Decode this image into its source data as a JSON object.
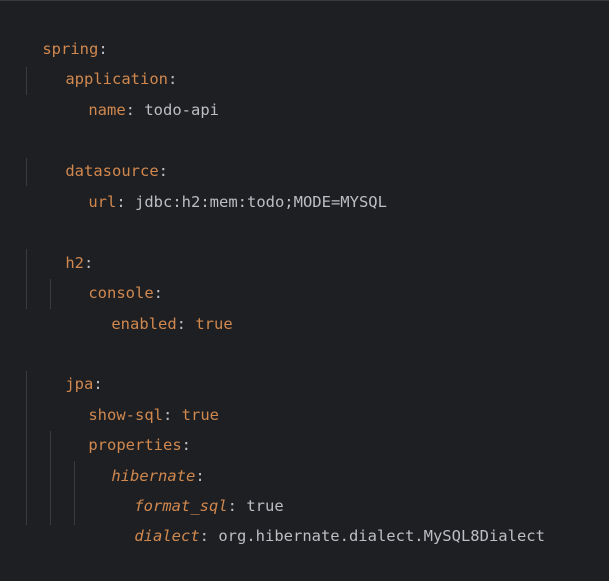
{
  "lines": [
    {
      "key": "spring",
      "value": ""
    },
    {
      "key": "application",
      "value": ""
    },
    {
      "key": "name",
      "value": "todo-api"
    },
    {
      "key": "datasource",
      "value": ""
    },
    {
      "key": "url",
      "value": "jdbc:h2:mem:todo;MODE=MYSQL"
    },
    {
      "key": "h2",
      "value": ""
    },
    {
      "key": "console",
      "value": ""
    },
    {
      "key": "enabled",
      "value": "true"
    },
    {
      "key": "jpa",
      "value": ""
    },
    {
      "key": "show-sql",
      "value": "true"
    },
    {
      "key": "properties",
      "value": ""
    },
    {
      "key": "hibernate",
      "value": ""
    },
    {
      "key": "format_sql",
      "value": "true"
    },
    {
      "key": "dialect",
      "value": "org.hibernate.dialect.MySQL8Dialect"
    }
  ],
  "colors": {
    "background": "#1e1f22",
    "key": "#d0884f",
    "text": "#bcbec4",
    "indent_guide": "#393b40"
  }
}
